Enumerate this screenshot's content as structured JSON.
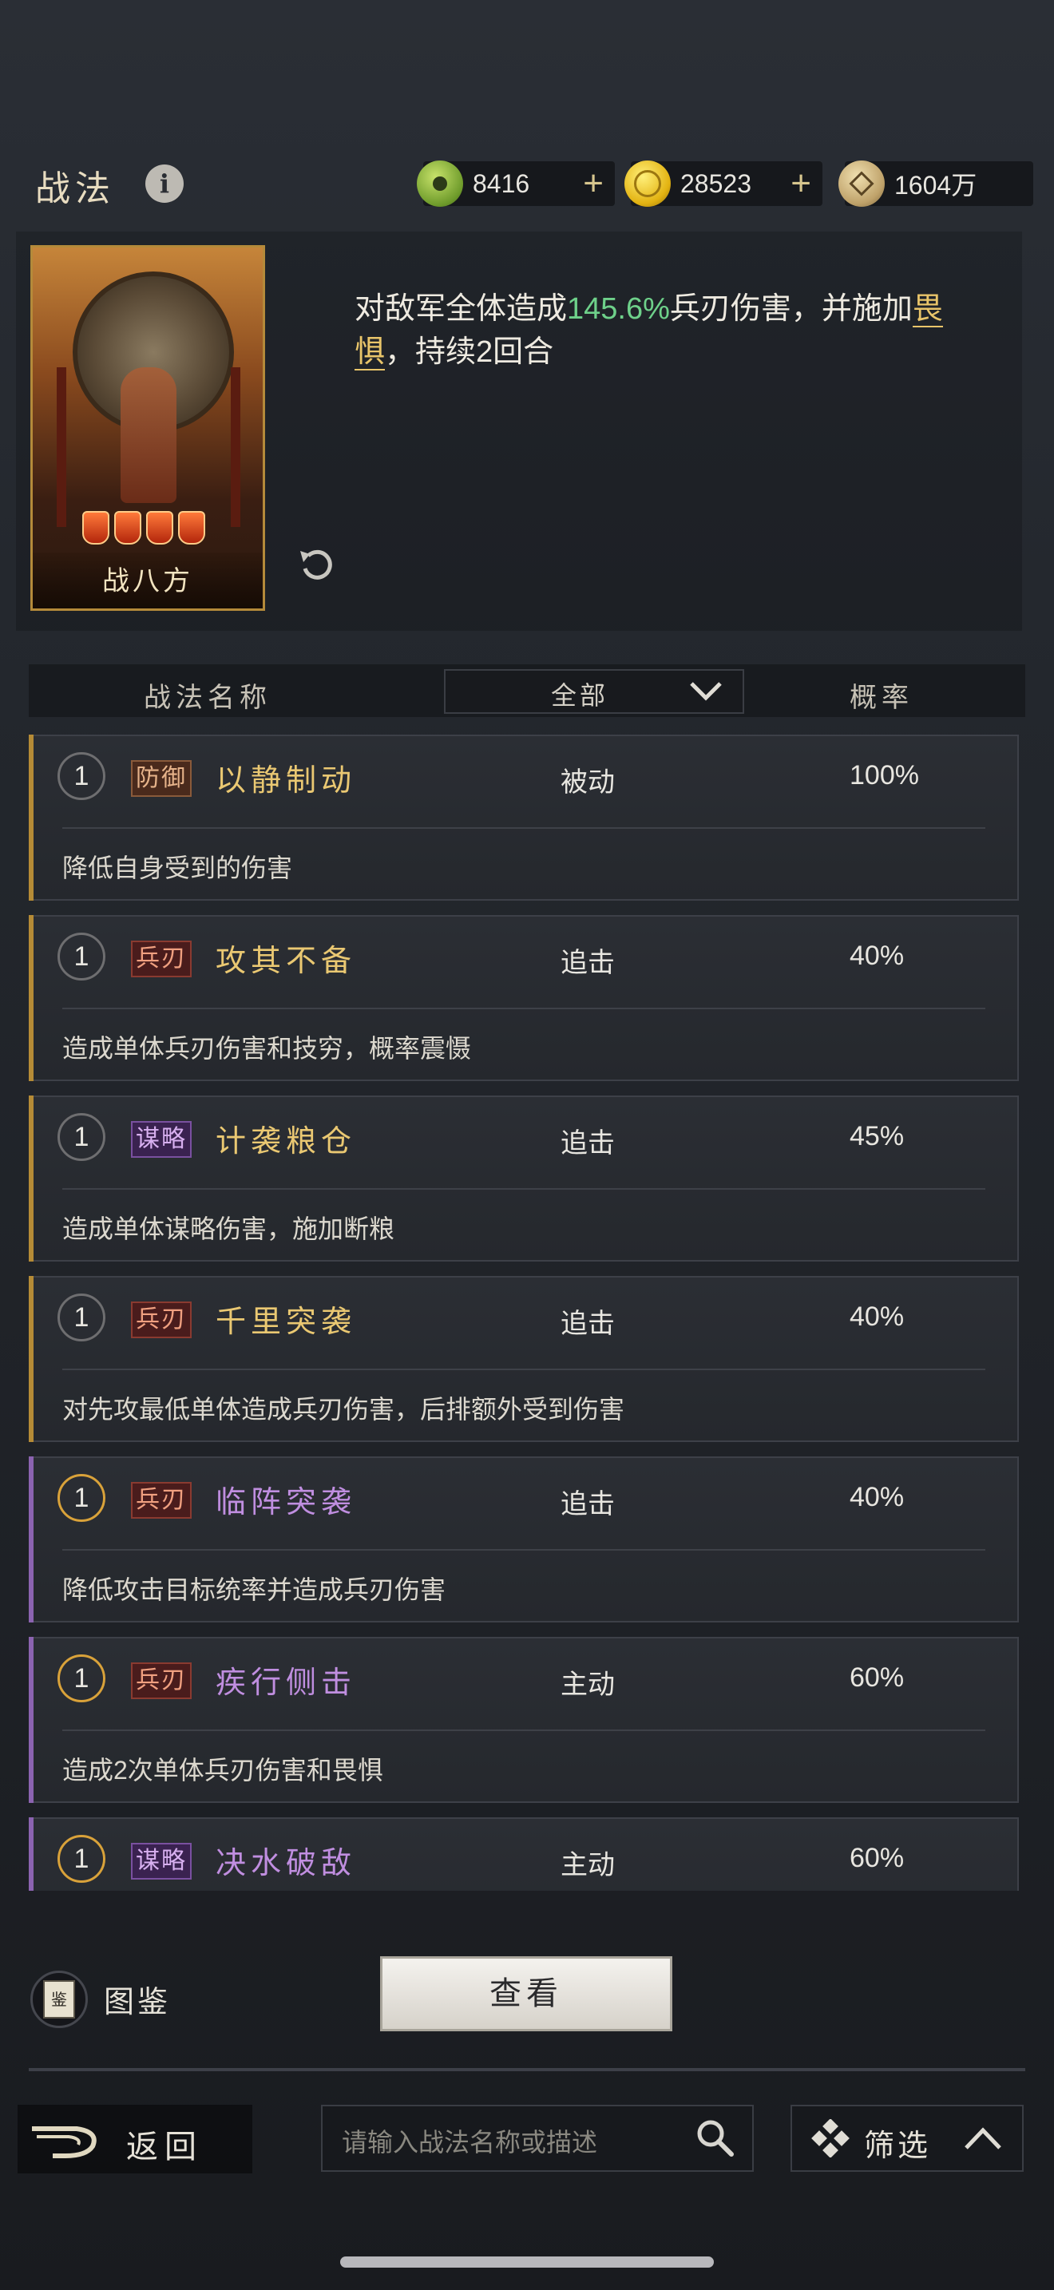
{
  "header": {
    "title": "战法",
    "resources": [
      {
        "icon": "jade-coin-icon",
        "value": "8416",
        "has_plus": true
      },
      {
        "icon": "gold-coin-icon",
        "value": "28523",
        "has_plus": true
      },
      {
        "icon": "copper-coin-icon",
        "value": "1604万",
        "has_plus": false
      }
    ]
  },
  "detail": {
    "card_name": "战八方",
    "description": {
      "part1": "对敌军全体造成",
      "percent": "145.6%",
      "part2": "兵刃伤害，并施加",
      "keyword": "畏惧",
      "part3": "，持续2回合"
    }
  },
  "table": {
    "col_name": "战法名称",
    "filter_value": "全部",
    "col_rate": "概率"
  },
  "skills": [
    {
      "level": "1",
      "tag": "防御",
      "tag_type": "def",
      "name": "以静制动",
      "type": "被动",
      "rate": "100%",
      "desc": "降低自身受到的伤害",
      "quality": "gold"
    },
    {
      "level": "1",
      "tag": "兵刃",
      "tag_type": "bld",
      "name": "攻其不备",
      "type": "追击",
      "rate": "40%",
      "desc": "造成单体兵刃伤害和技穷，概率震慑",
      "quality": "gold"
    },
    {
      "level": "1",
      "tag": "谋略",
      "tag_type": "stg",
      "name": "计袭粮仓",
      "type": "追击",
      "rate": "45%",
      "desc": "造成单体谋略伤害，施加断粮",
      "quality": "gold"
    },
    {
      "level": "1",
      "tag": "兵刃",
      "tag_type": "bld",
      "name": "千里突袭",
      "type": "追击",
      "rate": "40%",
      "desc": "对先攻最低单体造成兵刃伤害，后排额外受到伤害",
      "quality": "gold"
    },
    {
      "level": "1",
      "tag": "兵刃",
      "tag_type": "bld",
      "name": "临阵突袭",
      "type": "追击",
      "rate": "40%",
      "desc": "降低攻击目标统率并造成兵刃伤害",
      "quality": "purple"
    },
    {
      "level": "1",
      "tag": "兵刃",
      "tag_type": "bld",
      "name": "疾行侧击",
      "type": "主动",
      "rate": "60%",
      "desc": "造成2次单体兵刃伤害和畏惧",
      "quality": "purple"
    },
    {
      "level": "1",
      "tag": "谋略",
      "tag_type": "stg",
      "name": "决水破敌",
      "type": "主动",
      "rate": "60%",
      "desc": "",
      "quality": "purple"
    }
  ],
  "bottom": {
    "book_label": "图鉴",
    "book_icon_glyph": "鉴",
    "view_button": "查看",
    "back_label": "返回",
    "search_placeholder": "请输入战法名称或描述",
    "filter_label": "筛选"
  },
  "colors": {
    "gold_quality": "#b58b36",
    "purple_quality": "#8b63b0",
    "damage_percent": "#6ed18a",
    "keyword": "#e9c56a"
  }
}
